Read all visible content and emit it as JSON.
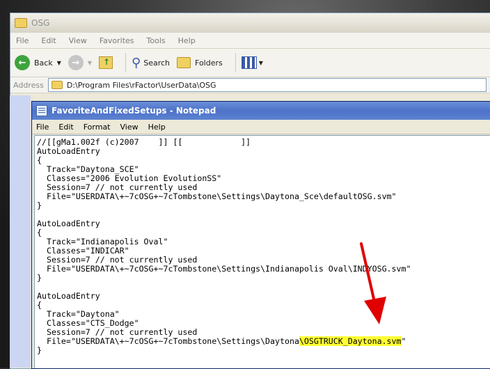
{
  "explorer": {
    "title": "OSG",
    "menu": [
      "File",
      "Edit",
      "View",
      "Favorites",
      "Tools",
      "Help"
    ],
    "toolbar": {
      "back_label": "Back",
      "search_label": "Search",
      "folders_label": "Folders"
    },
    "address_label": "Address",
    "address_value": "D:\\Program Files\\rFactor\\UserData\\OSG"
  },
  "notepad": {
    "title": "FavoriteAndFixedSetups - Notepad",
    "menu": [
      "File",
      "Edit",
      "Format",
      "View",
      "Help"
    ],
    "lines": [
      "//[[gMa1.002f (c)2007    ]] [[            ]]",
      "AutoLoadEntry",
      "{",
      "  Track=\"Daytona_SCE\"",
      "  Classes=\"2006 Evolution EvolutionSS\"",
      "  Session=7 // not currently used",
      "  File=\"USERDATA\\+~7cOSG+~7cTombstone\\Settings\\Daytona_Sce\\defaultOSG.svm\"",
      "}",
      "",
      "AutoLoadEntry",
      "{",
      "  Track=\"Indianapolis Oval\"",
      "  Classes=\"INDICAR\"",
      "  Session=7 // not currently used",
      "  File=\"USERDATA\\+~7cOSG+~7cTombstone\\Settings\\Indianapolis Oval\\INDYOSG.svm\"",
      "}",
      "",
      "AutoLoadEntry",
      "{",
      "  Track=\"Daytona\"",
      "  Classes=\"CTS_Dodge\"",
      "  Session=7 // not currently used"
    ],
    "last_line_prefix": "  File=\"USERDATA\\+~7cOSG+~7cTombstone\\Settings\\Daytona",
    "last_line_highlight": "\\OSGTRUCK_Daytona.svm",
    "last_line_suffix": "\"",
    "closing_brace": "}",
    "highlight_color": "#ffff33",
    "arrow_color": "#e00000"
  }
}
